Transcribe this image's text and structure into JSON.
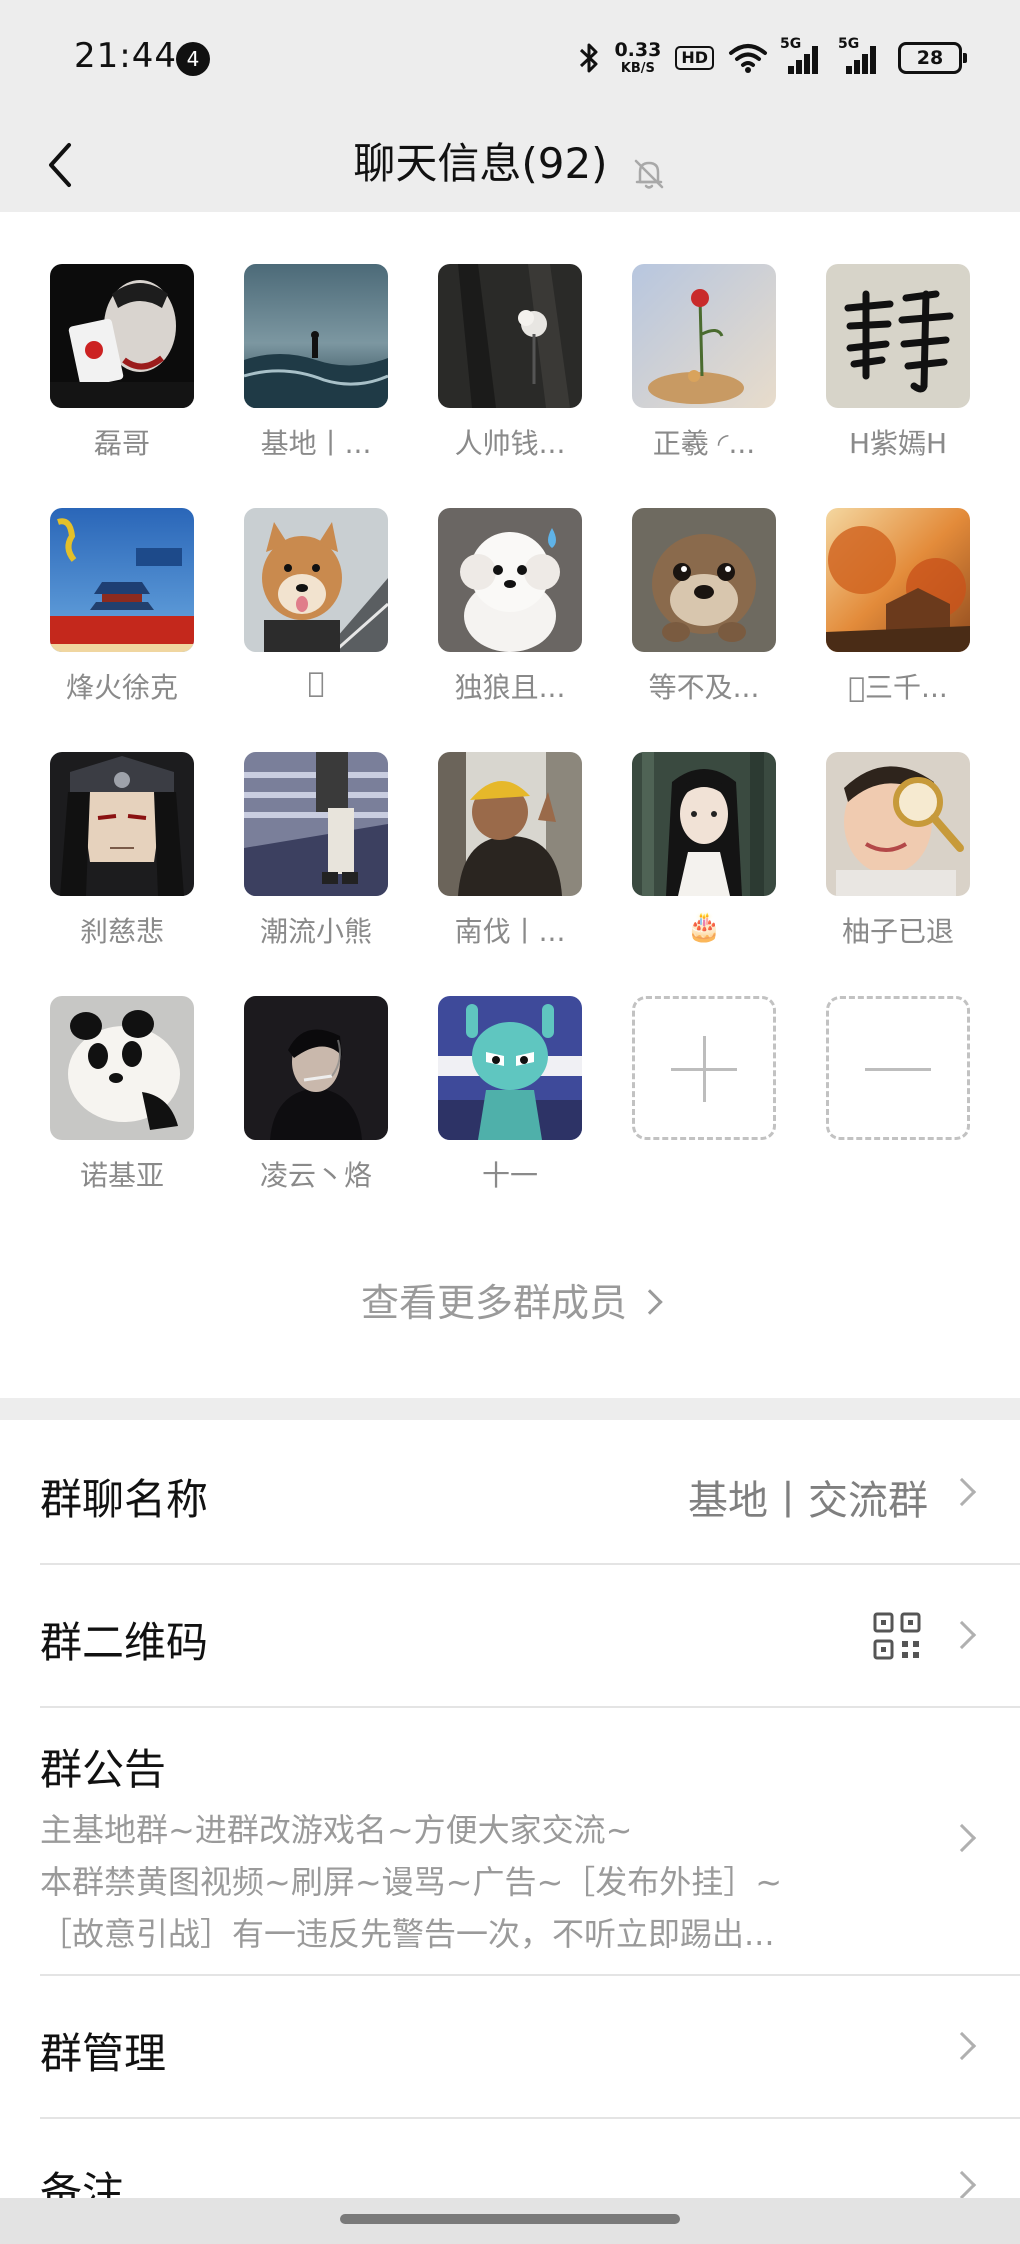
{
  "status_bar": {
    "time": "21:44",
    "notification_count": "4",
    "net_speed_value": "0.33",
    "net_speed_unit": "KB/S",
    "hd_label": "HD",
    "sim1_label": "5G",
    "sim2_label": "5G",
    "battery": "28"
  },
  "nav": {
    "title": "聊天信息(92)",
    "icons": [
      "chevron-left-icon",
      "bell-off-icon"
    ]
  },
  "members": [
    {
      "name": "磊哥",
      "avatar": "joker-card-avatar"
    },
    {
      "name": "基地丨...",
      "avatar": "stormy-sea-avatar"
    },
    {
      "name": "人帅钱...",
      "avatar": "dark-flower-avatar"
    },
    {
      "name": "正羲 ◜...",
      "avatar": "red-flower-avatar"
    },
    {
      "name": "H紫嫣H",
      "avatar": "calligraphy-jing-avatar"
    },
    {
      "name": "烽火徐克",
      "avatar": "temple-poster-avatar"
    },
    {
      "name": "󰀀",
      "avatar": "shiba-dog-avatar"
    },
    {
      "name": "独狼且...",
      "avatar": "white-puppy-avatar"
    },
    {
      "name": "等不及...",
      "avatar": "otter-avatar"
    },
    {
      "name": "󰀀三千...",
      "avatar": "autumn-landscape-avatar"
    },
    {
      "name": "刹慈悲",
      "avatar": "anime-ninja-avatar"
    },
    {
      "name": "潮流小熊",
      "avatar": "street-fashion-avatar"
    },
    {
      "name": "南伐丨...",
      "avatar": "yellow-hat-kid-avatar"
    },
    {
      "name": "🎂",
      "avatar": "anime-swordsman-avatar"
    },
    {
      "name": "柚子已退",
      "avatar": "magnifier-boy-avatar"
    },
    {
      "name": "诺基亚",
      "avatar": "panda-cub-avatar"
    },
    {
      "name": "凌云丶烙",
      "avatar": "smoking-man-avatar"
    },
    {
      "name": "十一",
      "avatar": "cartoon-robot-avatar"
    }
  ],
  "actions": {
    "add_icon": "plus-icon",
    "remove_icon": "minus-icon"
  },
  "view_more": "查看更多群成员",
  "settings": {
    "group_name_label": "群聊名称",
    "group_name_value": "基地丨交流群",
    "qr_label": "群二维码",
    "notice_label": "群公告",
    "notice_lines": [
      "主基地群~进群改游戏名~方便大家交流~",
      "本群禁黄图视频~刷屏~谩骂~广告~［发布外挂］~",
      "［故意引战］有一违反先警告一次，不听立即踢出..."
    ],
    "manage_label": "群管理",
    "remark_label": "备注"
  }
}
